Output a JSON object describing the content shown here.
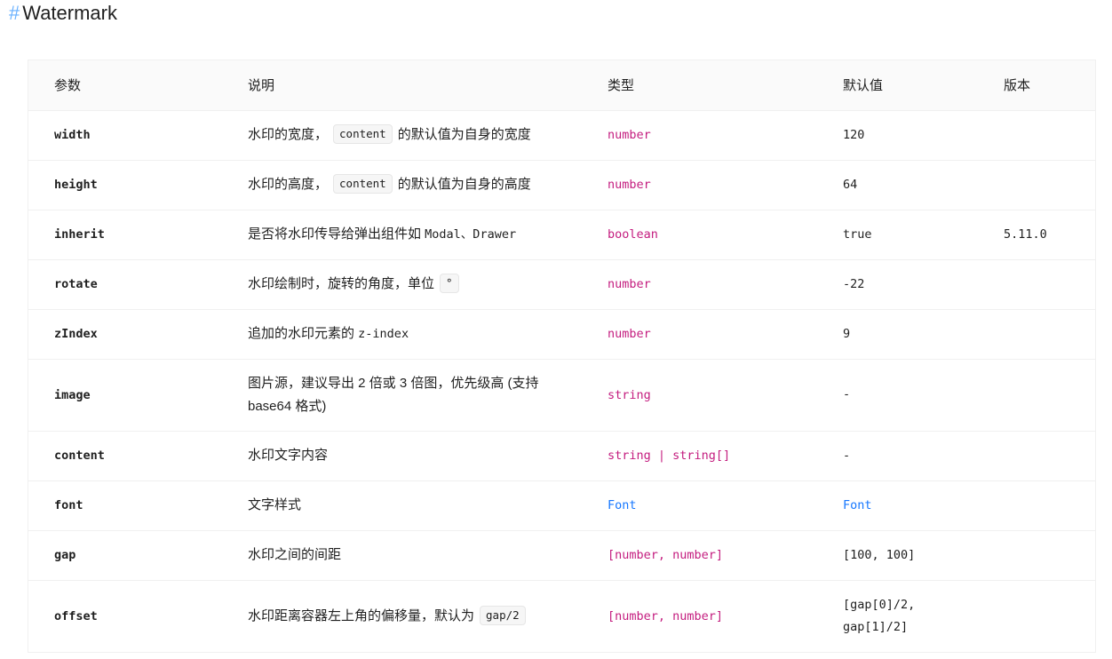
{
  "heading": {
    "anchor": "#",
    "title": "Watermark"
  },
  "table": {
    "headers": {
      "param": "参数",
      "desc": "说明",
      "type": "类型",
      "default": "默认值",
      "version": "版本"
    },
    "rows": [
      {
        "param": "width",
        "desc_before": "水印的宽度，",
        "desc_code": "content",
        "desc_after": "的默认值为自身的宽度",
        "type": "number",
        "default": "120",
        "version": ""
      },
      {
        "param": "height",
        "desc_before": "水印的高度，",
        "desc_code": "content",
        "desc_after": "的默认值为自身的高度",
        "type": "number",
        "default": "64",
        "version": ""
      },
      {
        "param": "inherit",
        "desc_before": "是否将水印传导给弹出组件如 ",
        "desc_mono": "Modal、Drawer",
        "type": "boolean",
        "default": "true",
        "version": "5.11.0"
      },
      {
        "param": "rotate",
        "desc_before": "水印绘制时，旋转的角度，单位",
        "desc_code": "°",
        "type": "number",
        "default": "-22",
        "version": ""
      },
      {
        "param": "zIndex",
        "desc_before": "追加的水印元素的 ",
        "desc_mono": "z-index",
        "type": "number",
        "default": "9",
        "version": ""
      },
      {
        "param": "image",
        "desc_text": "图片源，建议导出 2 倍或 3 倍图，优先级高 (支持 base64 格式)",
        "type": "string",
        "default": "-",
        "version": ""
      },
      {
        "param": "content",
        "desc_text": "水印文字内容",
        "type": "string | string[]",
        "default": "-",
        "version": ""
      },
      {
        "param": "font",
        "desc_text": "文字样式",
        "type": "Font",
        "default": "Font",
        "version": ""
      },
      {
        "param": "gap",
        "desc_text": "水印之间的间距",
        "type": "[number, number]",
        "default": "[100, 100]",
        "version": ""
      },
      {
        "param": "offset",
        "desc_before": "水印距离容器左上角的偏移量，默认为",
        "desc_code": "gap/2",
        "type": "[number, number]",
        "default_line1": "[gap[0]/2,",
        "default_line2": "gap[1]/2]",
        "version": ""
      }
    ]
  },
  "colors": {
    "type_text": "#c41d7f",
    "link": "#1677ff",
    "anchor": "#69b1ff",
    "header_bg": "#fafafa",
    "border": "#f0f0f0"
  }
}
